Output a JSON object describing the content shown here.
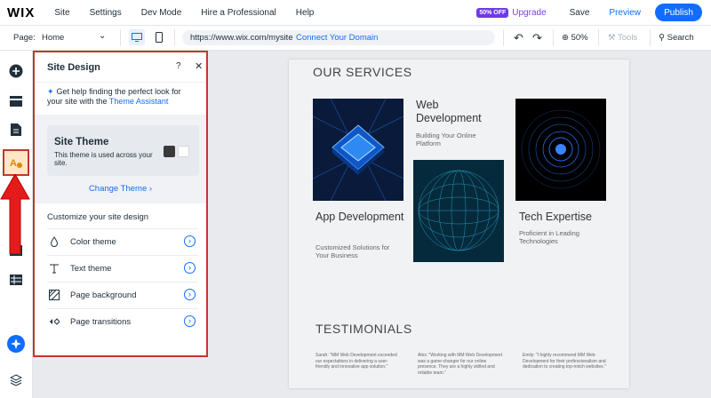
{
  "topbar": {
    "logo": "WIX",
    "menu": [
      "Site",
      "Settings",
      "Dev Mode",
      "Hire a Professional",
      "Help"
    ],
    "badge": "50% OFF",
    "upgrade": "Upgrade",
    "save": "Save",
    "preview": "Preview",
    "publish": "Publish"
  },
  "toolbar": {
    "page_label": "Page:",
    "page_value": "Home",
    "url": "https://www.wix.com/mysite",
    "connect_domain": "Connect Your Domain",
    "zoom": "50%",
    "tools": "Tools",
    "search": "Search"
  },
  "panel": {
    "title": "Site Design",
    "help": "?",
    "close": "✕",
    "assistant_text": "Get help finding the perfect look for your site with the ",
    "assistant_link": "Theme Assistant",
    "theme_name": "Site Theme",
    "theme_desc": "This theme is used across your site.",
    "change_theme": "Change Theme",
    "customize_title": "Customize your site design",
    "options": [
      {
        "label": "Color theme",
        "icon": "droplet-icon"
      },
      {
        "label": "Text theme",
        "icon": "text-icon"
      },
      {
        "label": "Page background",
        "icon": "background-icon"
      },
      {
        "label": "Page transitions",
        "icon": "transitions-icon"
      }
    ]
  },
  "site": {
    "services_title": "OUR SERVICES",
    "services": [
      {
        "title": "Web Development",
        "subtitle": "Building Your Online Platform"
      },
      {
        "title": "App Development",
        "subtitle": "Customized Solutions for Your Business"
      },
      {
        "title": "Tech Expertise",
        "subtitle": "Proficient in Leading Technologies"
      }
    ],
    "testimonials_title": "TESTIMONIALS",
    "quotes": [
      "Sarah: \"MM Web Development exceeded our expectations in delivering a user-friendly and innovative app solution.\"",
      "Alex: \"Working with MM Web Development was a game-changer for our online presence. They are a highly skilled and reliable team.\"",
      "Emily: \"I highly recommend MM Web Development for their professionalism and dedication to creating top-notch websites.\""
    ]
  },
  "colors": {
    "accent": "#116dff",
    "upgrade": "#7b3ff2",
    "highlight": "#c0392b"
  }
}
